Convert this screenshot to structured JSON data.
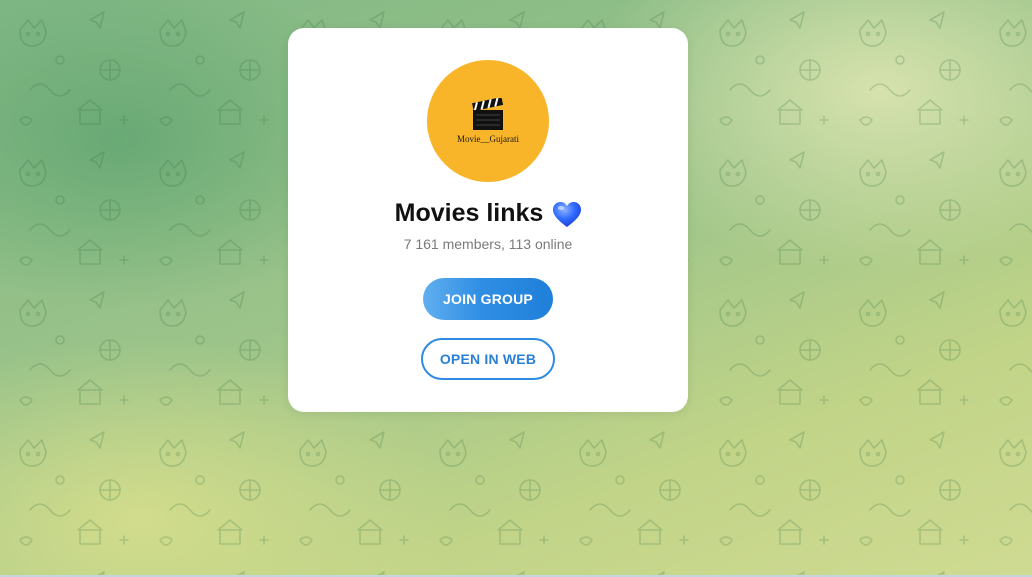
{
  "colors": {
    "card_bg": "#ffffff",
    "avatar_bg": "#f8b52a",
    "primary_blue": "#2f8ae2",
    "heart_blue": "#2f6bff"
  },
  "group": {
    "avatar_caption": "Movie__Gujarati",
    "avatar_icon": "clapperboard-icon",
    "title": "Movies links",
    "title_emoji": "blue-heart-icon",
    "stats": "7 161 members, 113 online"
  },
  "actions": {
    "join_label": "JOIN GROUP",
    "open_web_label": "OPEN IN WEB"
  }
}
